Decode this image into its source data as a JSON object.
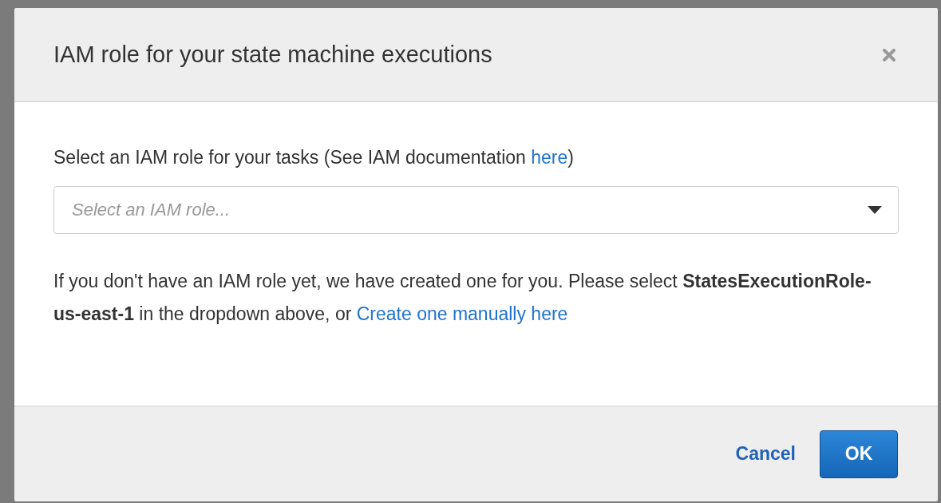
{
  "dialog": {
    "title": "IAM role for your state machine executions",
    "label": {
      "before": "Select an IAM role for your tasks (See IAM documentation ",
      "link": "here",
      "after": ")"
    },
    "role_select": {
      "placeholder": "Select an IAM role..."
    },
    "note": {
      "text": "If you don't have an IAM role yet, we have created one for you. Please select **StatesExecutionRole-us-east-1** in the dropdown above, or ",
      "link": "Create one manually here"
    },
    "buttons": [
      {
        "label": "Cancel",
        "kind": "link"
      },
      {
        "label": "OK",
        "kind": "primary"
      }
    ]
  }
}
